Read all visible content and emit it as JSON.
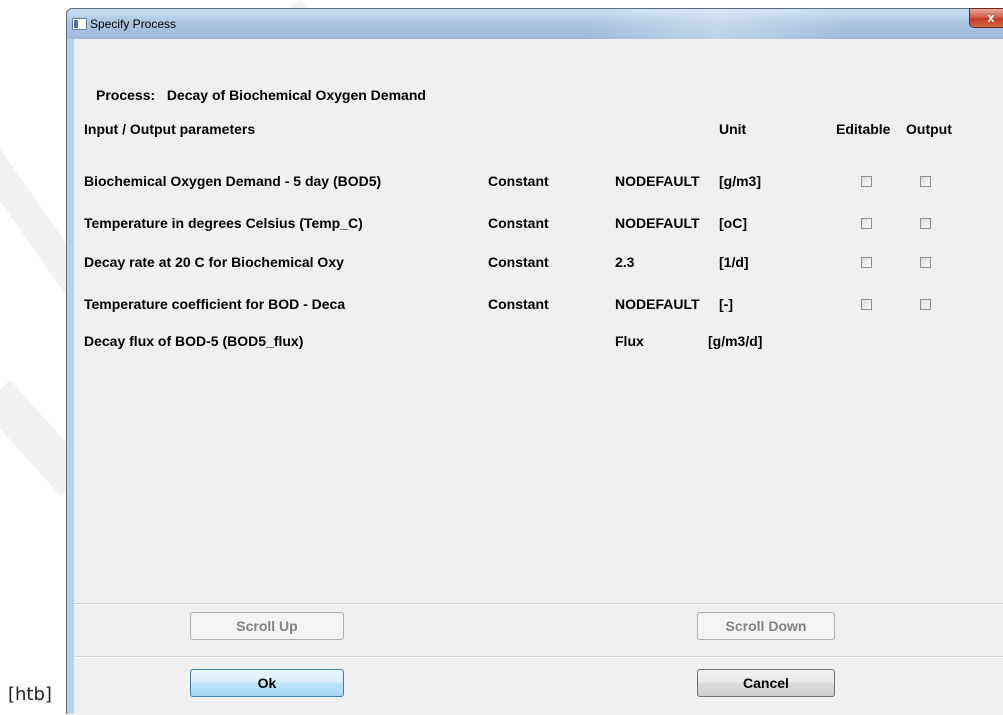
{
  "caption": "[htb]",
  "window": {
    "title": "Specify Process",
    "close_label": "x"
  },
  "process": {
    "label": "Process:",
    "name": "Decay of Biochemical Oxygen Demand"
  },
  "table": {
    "headers": {
      "parameters": "Input / Output parameters",
      "unit": "Unit",
      "editable": "Editable",
      "output": "Output"
    },
    "rows": [
      {
        "name": "Biochemical Oxygen Demand - 5 day (BOD5)",
        "type": "Constant",
        "value": "NODEFAULT",
        "unit": "[g/m3]",
        "editable": false,
        "output": false
      },
      {
        "name": "Temperature in degrees Celsius (Temp_C)",
        "type": "Constant",
        "value": "NODEFAULT",
        "unit": "[oC]",
        "editable": false,
        "output": false
      },
      {
        "name": "Decay rate at 20 C for Biochemical Oxy",
        "type": "Constant",
        "value": "2.3",
        "unit": "[1/d]",
        "editable": false,
        "output": false
      },
      {
        "name": "Temperature coefficient for BOD - Deca",
        "type": "Constant",
        "value": "NODEFAULT",
        "unit": "[-]",
        "editable": false,
        "output": false
      },
      {
        "name": "Decay flux of BOD-5 (BOD5_flux)",
        "type": "",
        "value": "Flux",
        "unit": "[g/m3/d]"
      }
    ]
  },
  "buttons": {
    "scroll_up": "Scroll Up",
    "scroll_down": "Scroll Down",
    "ok": "Ok",
    "cancel": "Cancel"
  }
}
